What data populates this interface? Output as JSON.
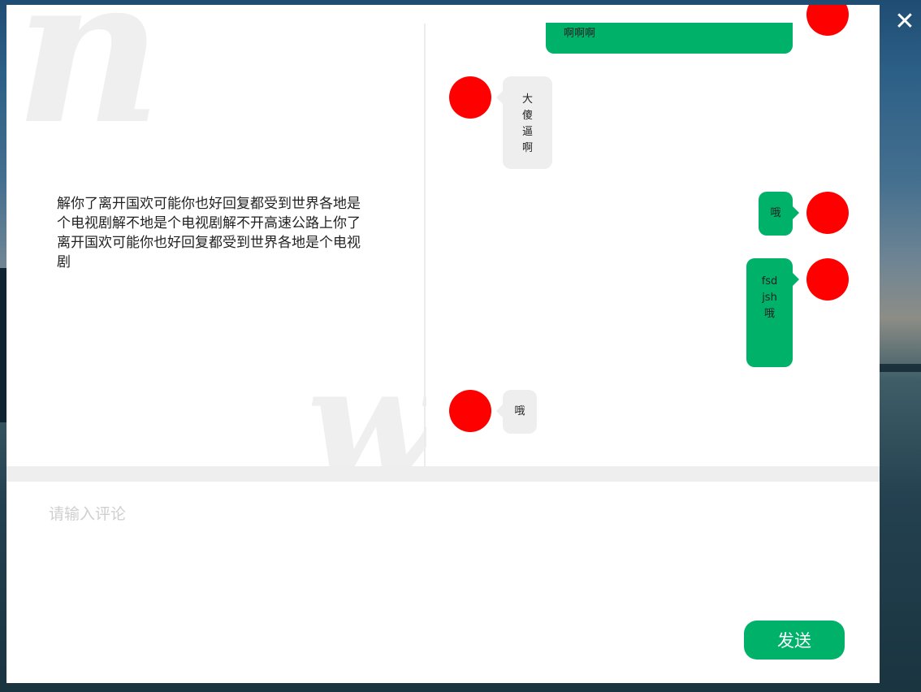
{
  "close_icon": "close-icon",
  "post": {
    "text": "解你了离开国欢可能你也好回复都受到世界各地是个电视剧解不地是个电视剧解不开高速公路上你了离开国欢可能你也好回复都受到世界各地是个电视剧"
  },
  "chat": {
    "messages": [
      {
        "side": "right",
        "text": "啊啊啊"
      },
      {
        "side": "left",
        "text": "大傻逼啊"
      },
      {
        "side": "right",
        "text": "哦"
      },
      {
        "side": "right",
        "text": "fsdjsh哦"
      },
      {
        "side": "left",
        "text": "哦"
      }
    ]
  },
  "comment": {
    "placeholder": "请输入评论",
    "value": ""
  },
  "send": {
    "label": "发送"
  },
  "colors": {
    "accent": "#00b16a",
    "avatar": "#ff0000",
    "bubble_in": "#eeeeee",
    "divider": "#eeeeee"
  }
}
